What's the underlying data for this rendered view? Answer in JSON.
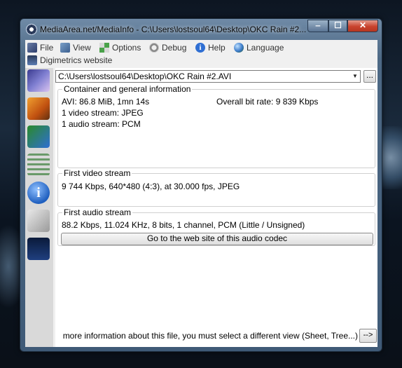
{
  "window": {
    "title": "MediaArea.net/MediaInfo - C:\\Users\\lostsoul64\\Desktop\\OKC Rain #2..."
  },
  "menu": {
    "file": "File",
    "view": "View",
    "options": "Options",
    "debug": "Debug",
    "help": "Help",
    "language": "Language",
    "digimetrics": "Digimetrics website"
  },
  "file_selector": {
    "value": "C:\\Users\\lostsoul64\\Desktop\\OKC Rain #2.AVI",
    "browse_label": "..."
  },
  "container": {
    "title": "Container and general information",
    "format_line": "AVI: 86.8 MiB, 1mn 14s",
    "bitrate": "Overall bit rate: 9 839 Kbps",
    "video_count": "1 video stream: JPEG",
    "audio_count": "1 audio stream: PCM"
  },
  "video": {
    "title": "First video stream",
    "details": "9 744 Kbps, 640*480 (4:3), at 30.000 fps, JPEG"
  },
  "audio": {
    "title": "First audio stream",
    "details": "88.2 Kbps, 11.024 KHz, 8 bits, 1 channel, PCM (Little / Unsigned)",
    "codec_button": "Go to the web site of this audio codec"
  },
  "hint": {
    "text": "more information about this file, you must select a different view (Sheet, Tree...)",
    "next_label": "-->"
  }
}
